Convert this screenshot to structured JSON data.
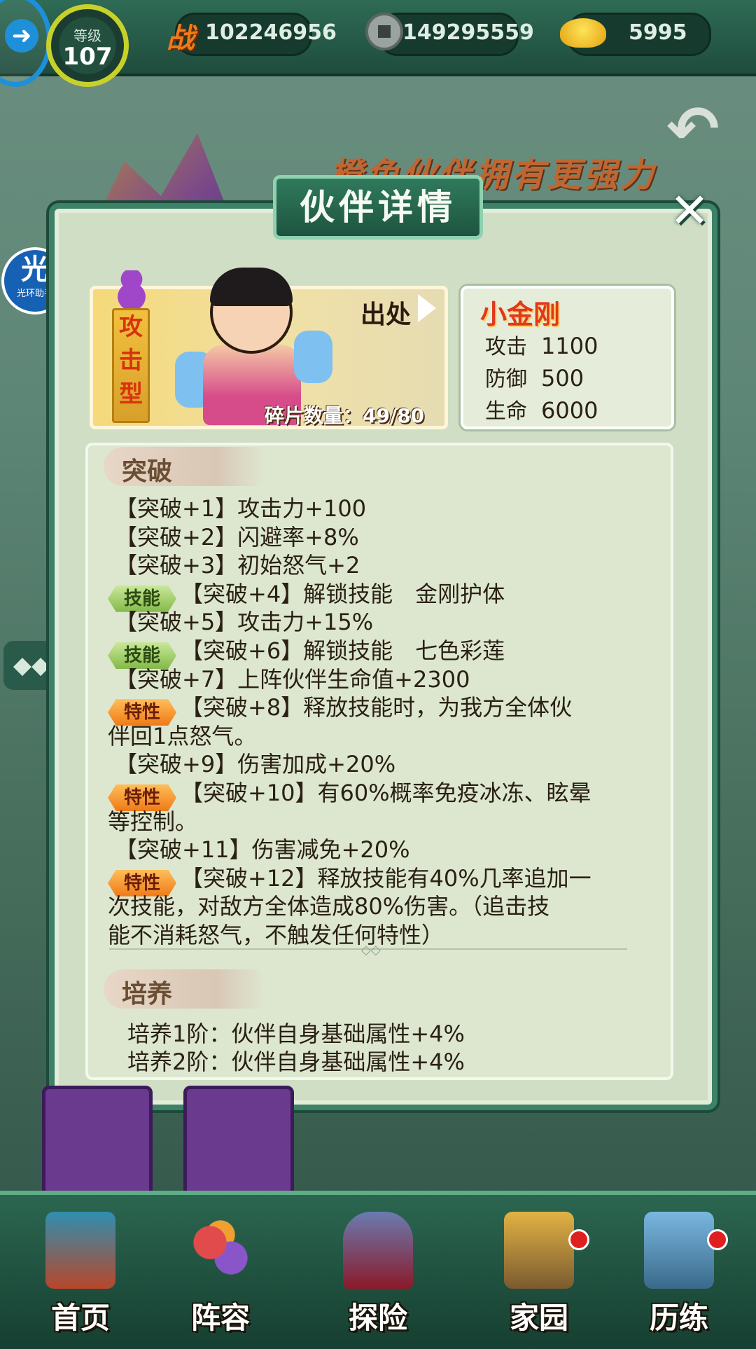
{
  "topbar": {
    "level_label": "等级",
    "level_value": "107",
    "power_icon": "战",
    "power_value": "102246956",
    "coins_value": "149295559",
    "gold_value": "5995"
  },
  "background": {
    "banner_text": "橙色伙伴拥有更强力"
  },
  "helper": {
    "big": "光",
    "small": "光环助手"
  },
  "modal": {
    "title": "伙伴详情",
    "hero": {
      "type_chars": [
        "攻",
        "击",
        "型"
      ],
      "source_label": "出处",
      "fragments_label": "碎片数量：49/80",
      "name": "小金刚",
      "stats": [
        {
          "key": "攻击",
          "value": "1100"
        },
        {
          "key": "防御",
          "value": "500"
        },
        {
          "key": "生命",
          "value": "6000"
        }
      ]
    },
    "breakthrough": {
      "heading": "突破",
      "lines": [
        {
          "badge": "",
          "text": "【突破+1】攻击力+100"
        },
        {
          "badge": "",
          "text": "【突破+2】闪避率+8%"
        },
        {
          "badge": "",
          "text": "【突破+3】初始怒气+2"
        },
        {
          "badge": "技能",
          "text": "【突破+4】解锁技能　金刚护体"
        },
        {
          "badge": "",
          "text": "【突破+5】攻击力+15%"
        },
        {
          "badge": "技能",
          "text": "【突破+6】解锁技能　七色彩莲"
        },
        {
          "badge": "",
          "text": "【突破+7】上阵伙伴生命值+2300"
        },
        {
          "badge": "特性",
          "text": "【突破+8】释放技能时，为我方全体伙"
        },
        {
          "badge": "",
          "text": "伴回1点怒气。"
        },
        {
          "badge": "",
          "text": "【突破+9】伤害加成+20%"
        },
        {
          "badge": "特性",
          "text": "【突破+10】有60%概率免疫冰冻、眩晕"
        },
        {
          "badge": "",
          "text": "等控制。"
        },
        {
          "badge": "",
          "text": "【突破+11】伤害减免+20%"
        },
        {
          "badge": "特性",
          "text": "【突破+12】释放技能有40%几率追加一"
        },
        {
          "badge": "",
          "text": "次技能，对敌方全体造成80%伤害。（追击技"
        },
        {
          "badge": "",
          "text": "能不消耗怒气，不触发任何特性）"
        }
      ]
    },
    "cultivate": {
      "heading": "培养",
      "lines": [
        "培养1阶：伙伴自身基础属性+4%",
        "培养2阶：伙伴自身基础属性+4%"
      ]
    }
  },
  "bottom_nav": [
    {
      "label": "首页",
      "icon": "temple-icon"
    },
    {
      "label": "阵容",
      "icon": "gourds-icon"
    },
    {
      "label": "探险",
      "icon": "cave-gate-icon"
    },
    {
      "label": "家园",
      "icon": "house-icon"
    },
    {
      "label": "历练",
      "icon": "sword-mountain-icon"
    }
  ],
  "colors": {
    "frame_green": "#3b8267",
    "skill_badge": "#84b948",
    "trait_badge": "#ef7a16",
    "hero_name": "#e2371b"
  }
}
